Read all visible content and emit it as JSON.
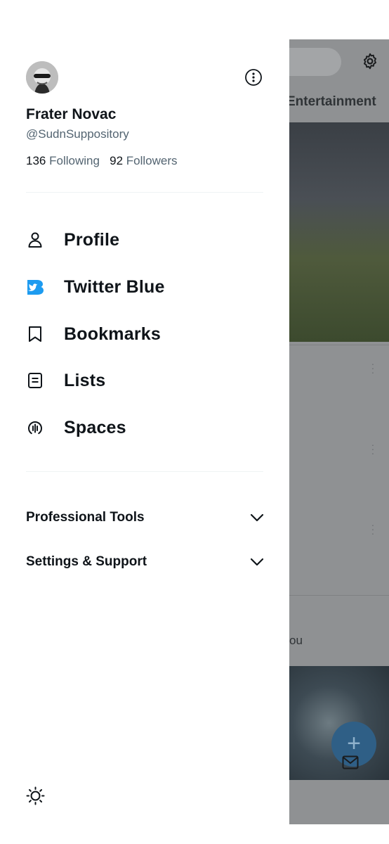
{
  "profile": {
    "display_name": "Frater Novac",
    "handle": "@SudnSuppository",
    "following_count": "136",
    "following_label": "Following",
    "followers_count": "92",
    "followers_label": "Followers"
  },
  "nav": {
    "items": [
      {
        "label": "Profile",
        "icon": "person-icon"
      },
      {
        "label": "Twitter Blue",
        "icon": "twitter-blue-icon"
      },
      {
        "label": "Bookmarks",
        "icon": "bookmark-icon"
      },
      {
        "label": "Lists",
        "icon": "list-icon"
      },
      {
        "label": "Spaces",
        "icon": "spaces-icon"
      }
    ]
  },
  "sections": {
    "professional_tools": "Professional Tools",
    "settings_support": "Settings & Support"
  },
  "background": {
    "tab_label": "Entertainment",
    "partial_text": "ou"
  },
  "colors": {
    "accent": "#1d9bf0",
    "text_primary": "#0f1419",
    "text_secondary": "#536471"
  }
}
